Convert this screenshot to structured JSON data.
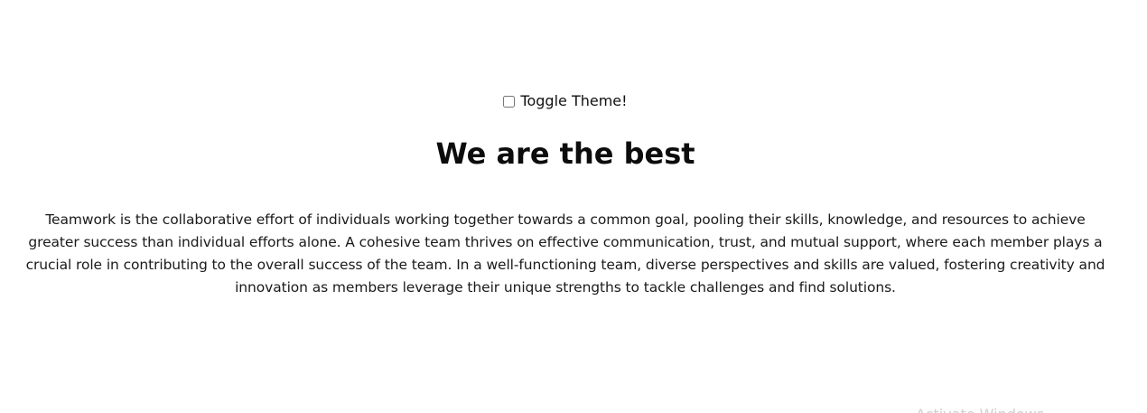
{
  "toggle": {
    "label": "Toggle Theme!",
    "checked": false
  },
  "title": "We are the best",
  "paragraph": "Teamwork is the collaborative effort of individuals working together towards a common goal, pooling their skills, knowledge, and resources to achieve greater success than individual efforts alone. A cohesive team thrives on effective communication, trust, and mutual support, where each member plays a crucial role in contributing to the overall success of the team. In a well-functioning team, diverse perspectives and skills are valued, fostering creativity and innovation as members leverage their unique strengths to tackle challenges and find solutions.",
  "watermark": "Activate Windows",
  "colors": {
    "background": "#ffffff",
    "text": "#111111",
    "watermark": "#cfcfcf"
  }
}
